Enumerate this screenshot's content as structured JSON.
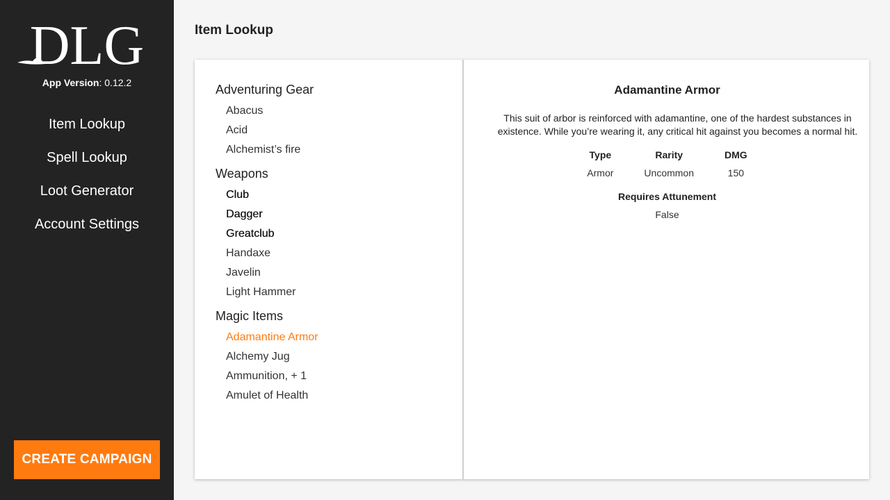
{
  "sidebar": {
    "logo_text": "DLG",
    "version_label": "App Version",
    "version_value": ": 0.12.2",
    "nav": [
      "Item Lookup",
      "Spell Lookup",
      "Loot Generator",
      "Account Settings"
    ],
    "cta_label": "CREATE CAMPAIGN"
  },
  "page": {
    "title": "Item Lookup"
  },
  "categories": [
    {
      "title": "Adventuring Gear",
      "items": [
        "Abacus",
        "Acid",
        "Alchemist’s fire"
      ]
    },
    {
      "title": "Weapons",
      "items": [
        "Club",
        "Dagger",
        "Greatclub",
        "Handaxe",
        "Javelin",
        "Light Hammer"
      ]
    },
    {
      "title": "Magic Items",
      "items": [
        "Adamantine Armor",
        "Alchemy Jug",
        "Ammunition, + 1",
        "Amulet of Health"
      ]
    }
  ],
  "detail": {
    "title": "Adamantine Armor",
    "description": "This suit of arbor is reinforced with adamantine, one of the hardest substances in existence. While you’re wearing it, any critical hit against you becomes a normal hit.",
    "stats": [
      {
        "label": "Type",
        "value": "Armor"
      },
      {
        "label": "Rarity",
        "value": "Uncommon"
      },
      {
        "label": "DMG",
        "value": "150"
      }
    ],
    "attunement": {
      "label": "Requires Attunement",
      "value": "False"
    }
  },
  "colors": {
    "accent": "#ff7b0f",
    "sidebar_bg": "#232323",
    "page_bg": "#f5f5f5"
  }
}
